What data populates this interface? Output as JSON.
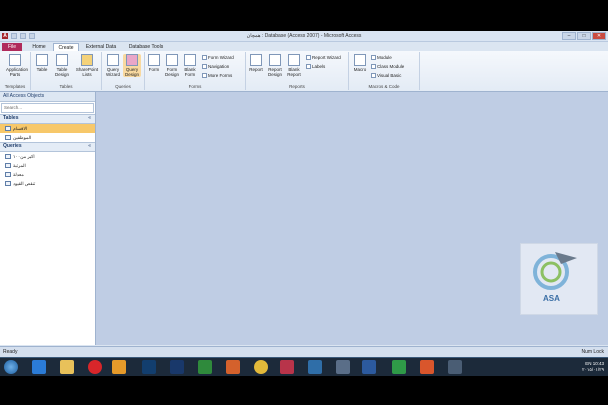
{
  "window": {
    "title": "همچان : Database (Access 2007) - Microsoft Access",
    "minimize": "–",
    "maximize": "□",
    "close": "✕"
  },
  "tabs": [
    "File",
    "Home",
    "Create",
    "External Data",
    "Database Tools"
  ],
  "ribbon": {
    "groups": [
      {
        "label": "Templates",
        "buttons": [
          "Application Parts"
        ]
      },
      {
        "label": "Tables",
        "buttons": [
          "Table",
          "Table Design",
          "SharePoint Lists"
        ]
      },
      {
        "label": "Queries",
        "buttons": [
          "Query Wizard",
          "Query Design"
        ]
      },
      {
        "label": "Forms",
        "buttons": [
          "Form",
          "Form Design",
          "Blank Form"
        ],
        "small": [
          "Form Wizard",
          "Navigation",
          "More Forms"
        ]
      },
      {
        "label": "Reports",
        "buttons": [
          "Report",
          "Report Design",
          "Blank Report"
        ],
        "small": [
          "Report Wizard",
          "Labels"
        ]
      },
      {
        "label": "Macros & Code",
        "buttons": [
          "Macro"
        ],
        "small": [
          "Module",
          "Class Module",
          "Visual Basic"
        ]
      }
    ]
  },
  "nav": {
    "header": "All Access Objects",
    "search_placeholder": "Search...",
    "sections": [
      {
        "title": "Tables",
        "items": [
          "الاقسام",
          "الموظفين"
        ]
      },
      {
        "title": "Queries",
        "items": [
          "اكبر من١٠٠",
          "المرتبة",
          "معدلة",
          "تنقص القيود"
        ]
      }
    ]
  },
  "status": {
    "left": "Ready",
    "right": "Num Lock"
  },
  "watermark": {
    "text": "ASA"
  },
  "tray": {
    "time": "10:43",
    "date": "٢٠١٥/٠١/٢٩",
    "lang": "EN"
  }
}
